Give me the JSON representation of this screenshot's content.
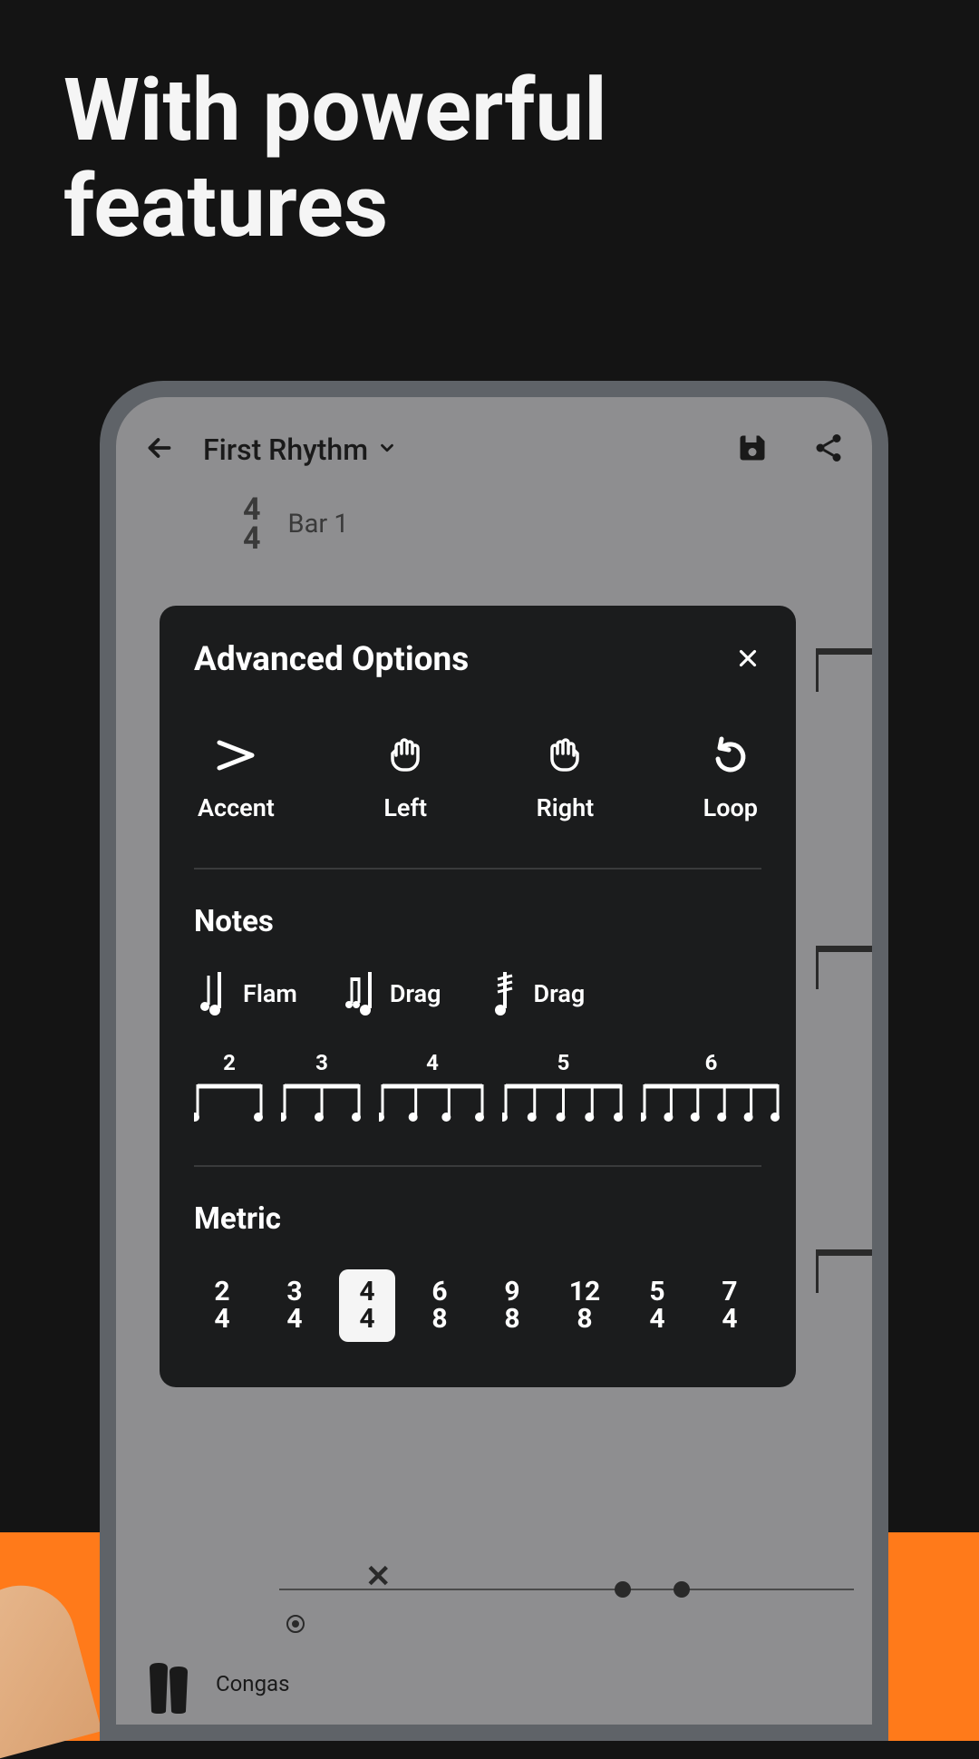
{
  "marketing": {
    "headline_line1": "With powerful",
    "headline_line2": "features"
  },
  "app": {
    "title": "First Rhythm",
    "bar_label": "Bar 1",
    "time_signature": {
      "top": "4",
      "bottom": "4"
    },
    "instrument_label": "Congas"
  },
  "modal": {
    "title": "Advanced Options",
    "actions": [
      {
        "label": "Accent",
        "icon": "accent"
      },
      {
        "label": "Left",
        "icon": "hand-left"
      },
      {
        "label": "Right",
        "icon": "hand-right"
      },
      {
        "label": "Loop",
        "icon": "loop"
      }
    ],
    "notes_section_title": "Notes",
    "note_types": [
      {
        "label": "Flam",
        "icon": "flam"
      },
      {
        "label": "Drag",
        "icon": "drag"
      },
      {
        "label": "Drag",
        "icon": "drag-roll"
      }
    ],
    "tuplets": [
      2,
      3,
      4,
      5,
      6
    ],
    "metric_section_title": "Metric",
    "metrics": [
      {
        "top": "2",
        "bottom": "4",
        "selected": false
      },
      {
        "top": "3",
        "bottom": "4",
        "selected": false
      },
      {
        "top": "4",
        "bottom": "4",
        "selected": true
      },
      {
        "top": "6",
        "bottom": "8",
        "selected": false
      },
      {
        "top": "9",
        "bottom": "8",
        "selected": false
      },
      {
        "top": "12",
        "bottom": "8",
        "selected": false
      },
      {
        "top": "5",
        "bottom": "4",
        "selected": false
      },
      {
        "top": "7",
        "bottom": "4",
        "selected": false
      }
    ]
  }
}
